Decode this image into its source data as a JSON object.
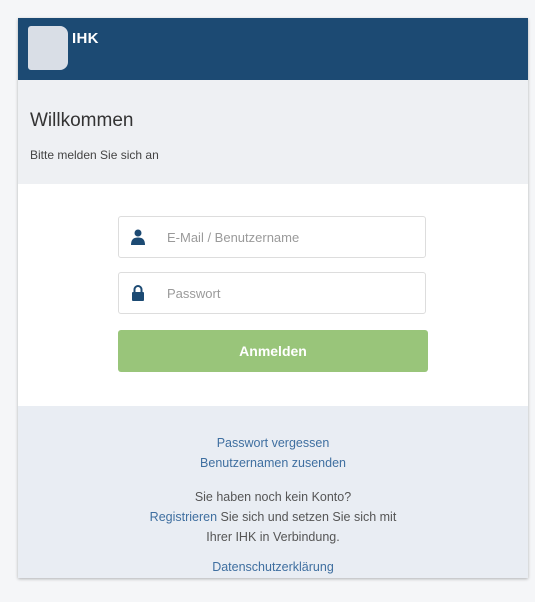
{
  "header": {
    "logo_text": "IHK",
    "brand_color": "#1c4a73"
  },
  "welcome": {
    "title": "Willkommen",
    "subtitle": "Bitte melden Sie sich an"
  },
  "form": {
    "username_placeholder": "E-Mail / Benutzername",
    "username_icon": "user-icon",
    "password_placeholder": "Passwort",
    "password_icon": "lock-icon",
    "login_label": "Anmelden",
    "login_color": "#99c57a"
  },
  "footer": {
    "forgot_password": "Passwort vergessen",
    "send_username": "Benutzernamen zusenden",
    "no_account": "Sie haben noch kein Konto?",
    "register_link": "Registrieren",
    "register_rest": " Sie sich und setzen Sie sich mit",
    "register_line2": "Ihrer IHK in Verbindung.",
    "privacy": "Datenschutzerklärung"
  }
}
